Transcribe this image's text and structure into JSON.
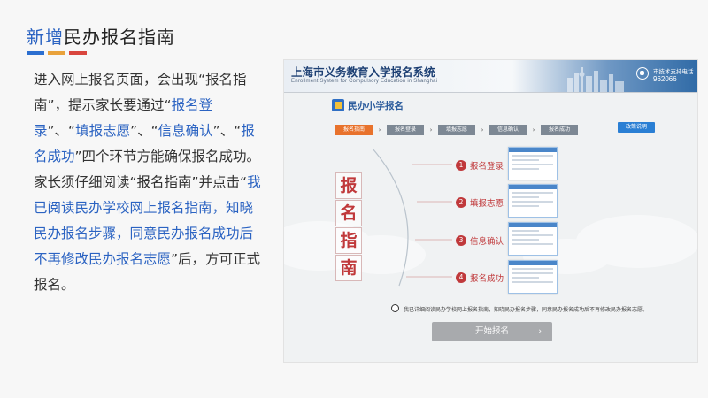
{
  "slide": {
    "title_prefix": "新增",
    "title_main": "民办报名指南",
    "para1_a": "进入网上报名页面，会出现“报名指南”，提示家长要通过“",
    "para1_b": "报名登录",
    "para1_c": "”、“",
    "para1_d": "填报志愿",
    "para1_e": "”、“",
    "para1_f": "信息确认",
    "para1_g": "”、“",
    "para1_h": "报名成功",
    "para1_i": "”四个环节方能确保报名成功。",
    "para2_a": "家长须仔细阅读“报名指南”并点击“",
    "para2_b": "我已阅读民办学校网上报名指南，知晓民办报名步骤，同意民办报名成功后不再修改民办报名志愿",
    "para2_c": "”后，方可正式报名。"
  },
  "screenshot": {
    "banner_title": "上海市义务教育入学报名系统",
    "banner_subtitle": "Enrollment System for Compulsory Education in Shanghai",
    "support_label": "市技术支持电话",
    "support_number": "962066",
    "section_title": "民办小学报名",
    "steps": [
      "报名指南",
      "报名登录",
      "填报志愿",
      "信息确认",
      "报名成功"
    ],
    "active_step": 0,
    "guide_button": "政策说明",
    "vertical_title": [
      "报",
      "名",
      "指",
      "南"
    ],
    "list_steps": [
      {
        "num": "1",
        "label": "报名登录"
      },
      {
        "num": "2",
        "label": "填报志愿"
      },
      {
        "num": "3",
        "label": "信息确认"
      },
      {
        "num": "4",
        "label": "报名成功"
      }
    ],
    "agree_text": "我已详细阅读民办学校网上报名指南，知晓民办报名步骤，同意民办报名成功后不再修改民办报名志愿。",
    "start_button": "开始报名",
    "start_chevron": "›"
  },
  "colors": {
    "accent_blue": "#2b63c2",
    "step_red": "#c0393b",
    "active_orange": "#e8722c"
  }
}
